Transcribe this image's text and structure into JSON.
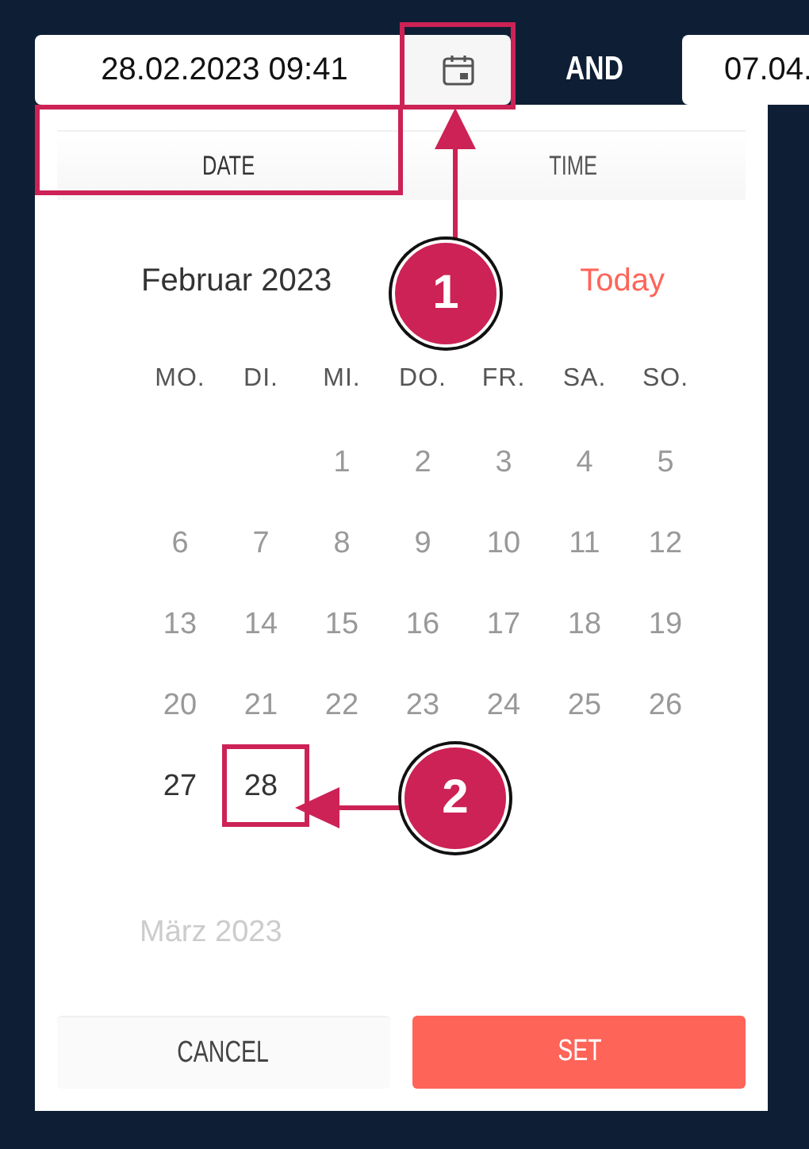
{
  "start_field": {
    "value": "28.02.2023 09:41"
  },
  "separator": "AND",
  "end_field": {
    "value": "07.04."
  },
  "tabs": [
    {
      "label": "DATE",
      "selected": true
    },
    {
      "label": "TIME",
      "selected": false
    }
  ],
  "calendar": {
    "month": "Februar 2023",
    "today": "Today",
    "weekdays": [
      "MO.",
      "DI.",
      "MI.",
      "DO.",
      "FR.",
      "SA.",
      "SO."
    ],
    "weeks": [
      [
        {
          "label": "1",
          "disabled": true
        },
        {
          "label": "2",
          "disabled": true
        },
        {
          "label": "3",
          "disabled": true
        },
        {
          "label": "4",
          "disabled": true
        },
        {
          "label": "5",
          "disabled": true
        }
      ],
      [
        {
          "label": "6",
          "disabled": true
        },
        {
          "label": "7",
          "disabled": true
        },
        {
          "label": "8",
          "disabled": true
        },
        {
          "label": "9",
          "disabled": true
        },
        {
          "label": "10",
          "disabled": true
        },
        {
          "label": "11",
          "disabled": true
        },
        {
          "label": "12",
          "disabled": true
        }
      ],
      [
        {
          "label": "13",
          "disabled": true
        },
        {
          "label": "14",
          "disabled": true
        },
        {
          "label": "15",
          "disabled": true
        },
        {
          "label": "16",
          "disabled": true
        },
        {
          "label": "17",
          "disabled": true
        },
        {
          "label": "18",
          "disabled": true
        },
        {
          "label": "19",
          "disabled": true
        }
      ],
      [
        {
          "label": "20",
          "disabled": true
        },
        {
          "label": "21",
          "disabled": true
        },
        {
          "label": "22",
          "disabled": true
        },
        {
          "label": "23",
          "disabled": true
        },
        {
          "label": "24",
          "disabled": true
        },
        {
          "label": "25",
          "disabled": true
        },
        {
          "label": "26",
          "disabled": true
        }
      ],
      [
        {
          "label": "27",
          "disabled": false
        },
        {
          "label": "28",
          "disabled": false
        }
      ]
    ],
    "next_month": "März 2023"
  },
  "buttons": [
    {
      "label": "CANCEL",
      "kind": "secondary"
    },
    {
      "label": "SET",
      "kind": "primary"
    }
  ],
  "annotations": [
    {
      "number": "1"
    },
    {
      "number": "2"
    }
  ]
}
